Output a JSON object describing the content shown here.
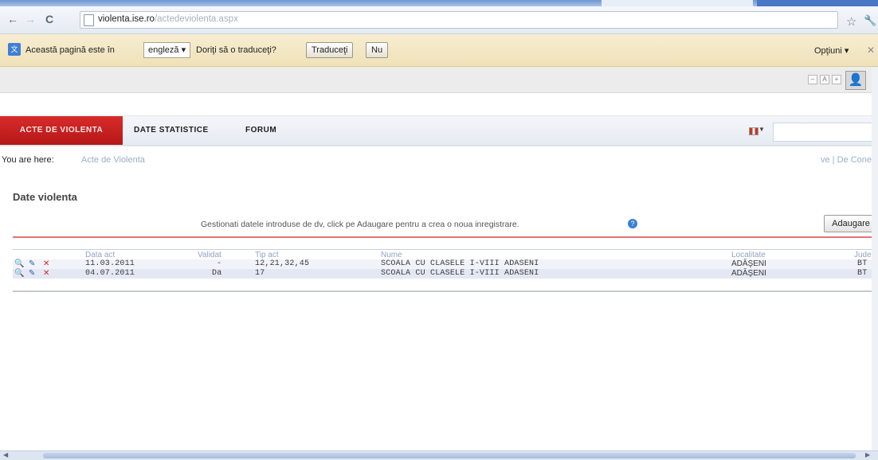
{
  "browser": {
    "url_host": "violenta.ise.ro",
    "url_path": "/actedeviolenta.aspx"
  },
  "translate_bar": {
    "message_prefix": "Această pagină este în",
    "language": "engleză",
    "question": "Doriţi să o traduceţi?",
    "translate_button": "Traduceţi",
    "no_button": "Nu",
    "options": "Opţiuni"
  },
  "nav": {
    "tabs": [
      {
        "label": "ACTE DE VIOLENTA",
        "active": true
      },
      {
        "label": "DATE STATISTICE",
        "active": false
      },
      {
        "label": "FORUM",
        "active": false
      }
    ],
    "accent_color": "#c81e1e"
  },
  "breadcrumb": {
    "label": "You are here:",
    "current": "Acte de Violenta",
    "right_text": "ve  |  De Conec"
  },
  "page": {
    "title": "Date violenta",
    "instructions": "Gestionati datele introduse de dv, click pe Adaugare pentru a crea o noua inregistrare.",
    "add_button": "Adaugare"
  },
  "table": {
    "headers": {
      "date": "Data act",
      "validated": "Validat",
      "type": "Tip act",
      "name": "Nume",
      "locality": "Localitate",
      "county": "Judet"
    },
    "rows": [
      {
        "date": "11.03.2011",
        "validated": "-",
        "type": "12,21,32,45",
        "name": "SCOALA CU CLASELE I-VIII ADASENI",
        "locality": "ADĂŞENI",
        "county": "BT"
      },
      {
        "date": "04.07.2011",
        "validated": "Da",
        "type": "17",
        "name": "SCOALA CU CLASELE I-VIII ADASENI",
        "locality": "ADĂŞENI",
        "county": "BT"
      }
    ]
  }
}
